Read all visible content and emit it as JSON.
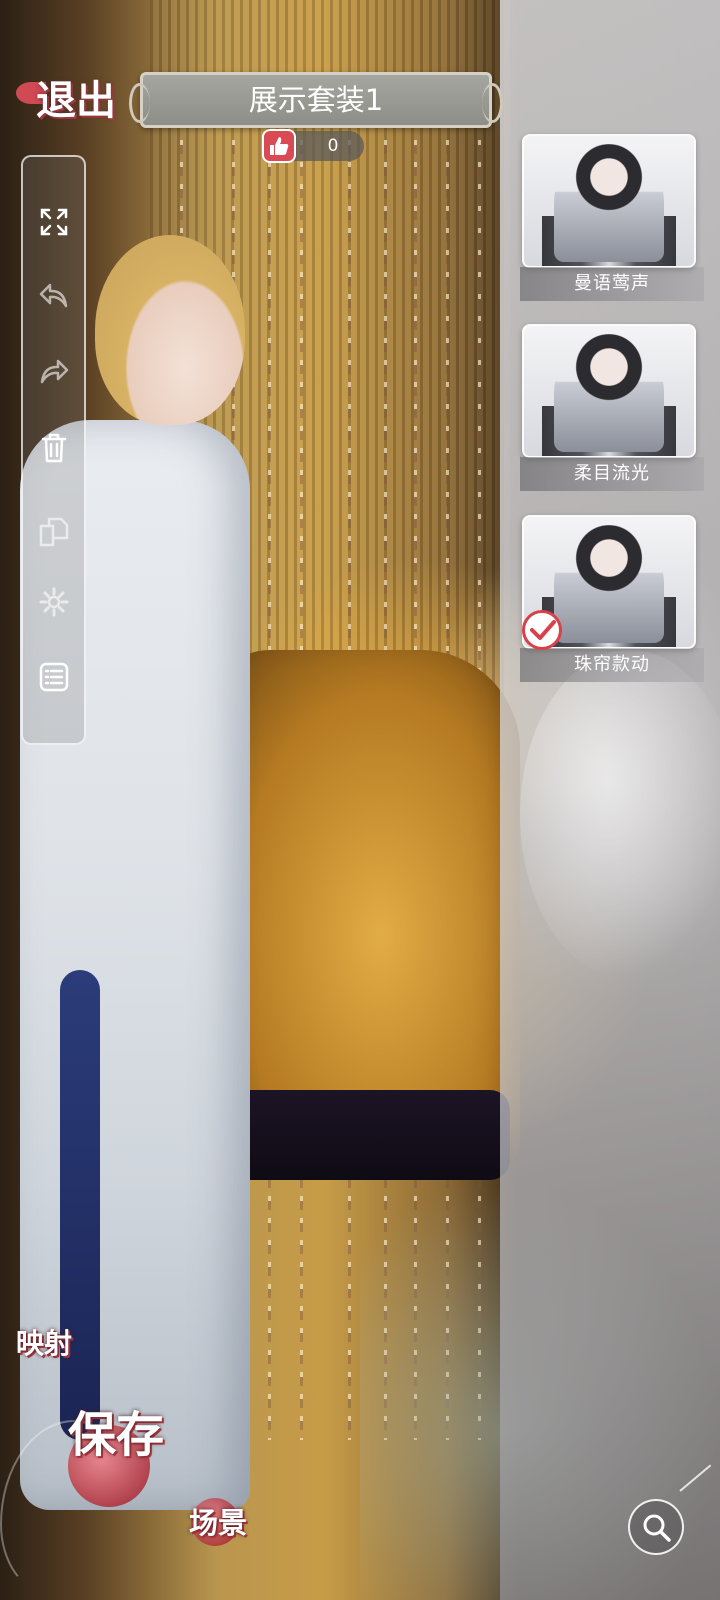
{
  "header": {
    "exit_label": "退出",
    "title": "展示套装1",
    "like_count": "0"
  },
  "toolbar": {
    "items": [
      {
        "icon": "expand-icon"
      },
      {
        "icon": "undo-icon"
      },
      {
        "icon": "redo-icon"
      },
      {
        "icon": "trash-icon"
      },
      {
        "icon": "copy-icon"
      },
      {
        "icon": "gear-icon"
      },
      {
        "icon": "list-icon"
      }
    ]
  },
  "suits": [
    {
      "label": "曼语莺声",
      "selected": false
    },
    {
      "label": "柔目流光",
      "selected": false
    },
    {
      "label": "珠帘款动",
      "selected": true
    }
  ],
  "actions": {
    "mirror_label": "映射",
    "save_label": "保存",
    "scene_label": "场景",
    "search_icon": "search-icon"
  },
  "colors": {
    "accent_red": "#d94a54",
    "panel_text": "#ffffff"
  }
}
